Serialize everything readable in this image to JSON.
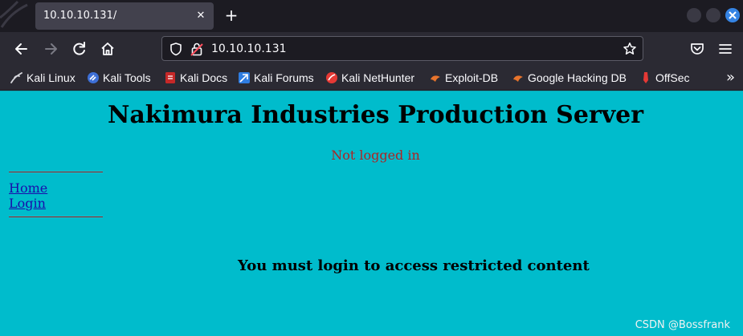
{
  "browser": {
    "tab_title": "10.10.10.131/",
    "url": "10.10.10.131"
  },
  "bookmarks": [
    {
      "label": "Kali Linux",
      "icon": "kali-dragon-icon"
    },
    {
      "label": "Kali Tools",
      "icon": "kali-tools-icon"
    },
    {
      "label": "Kali Docs",
      "icon": "kali-docs-icon"
    },
    {
      "label": "Kali Forums",
      "icon": "kali-forums-icon"
    },
    {
      "label": "Kali NetHunter",
      "icon": "kali-nethunter-icon"
    },
    {
      "label": "Exploit-DB",
      "icon": "exploit-db-icon"
    },
    {
      "label": "Google Hacking DB",
      "icon": "ghdb-icon"
    },
    {
      "label": "OffSec",
      "icon": "offsec-icon"
    }
  ],
  "page": {
    "title": "Nakimura Industries Production Server",
    "status": "Not logged in",
    "nav": [
      "Home",
      "Login"
    ],
    "message": "You must login to access restricted content"
  },
  "watermark": "CSDN @Bossfrank",
  "colors": {
    "page_background": "#00bccc",
    "status_text": "#b22222",
    "link": "#1a0dab",
    "browser_chrome": "#2b2a33"
  }
}
